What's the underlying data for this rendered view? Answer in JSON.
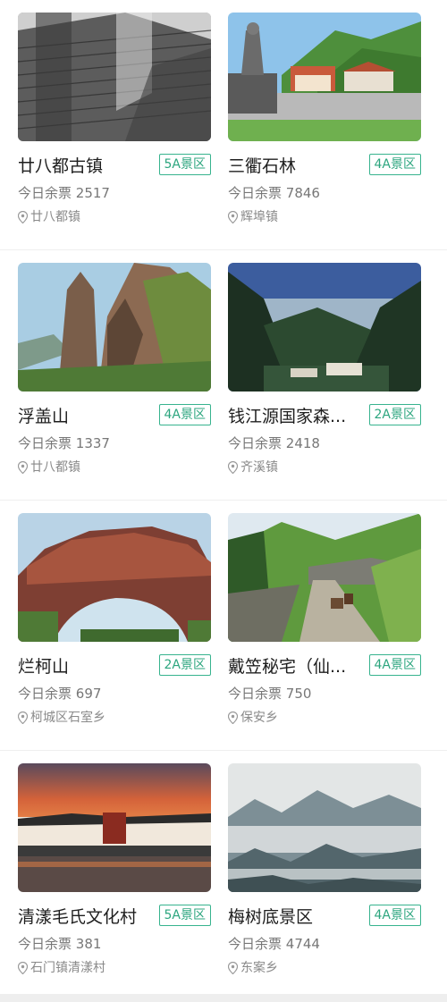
{
  "attractions": [
    {
      "name": "廿八都古镇",
      "grade": "5A景区",
      "tickets_label": "今日余票",
      "tickets": "2517",
      "location": "廿八都镇",
      "image": "old-town-rooftops-photo"
    },
    {
      "name": "三衢石林",
      "grade": "4A景区",
      "tickets_label": "今日余票",
      "tickets": "7846",
      "location": "辉埠镇",
      "image": "stone-forest-entrance-photo"
    },
    {
      "name": "浮盖山",
      "grade": "4A景区",
      "tickets_label": "今日余票",
      "tickets": "1337",
      "location": "廿八都镇",
      "image": "granite-peak-photo"
    },
    {
      "name": "钱江源国家森...",
      "grade": "2A景区",
      "tickets_label": "今日余票",
      "tickets": "2418",
      "location": "齐溪镇",
      "image": "misty-forest-valley-photo"
    },
    {
      "name": "烂柯山",
      "grade": "2A景区",
      "tickets_label": "今日余票",
      "tickets": "697",
      "location": "柯城区石室乡",
      "image": "rock-arch-photo"
    },
    {
      "name": "戴笠秘宅（仙...",
      "grade": "4A景区",
      "tickets_label": "今日余票",
      "tickets": "750",
      "location": "保安乡",
      "image": "mountain-path-horses-photo"
    },
    {
      "name": "清漾毛氏文化村",
      "grade": "5A景区",
      "tickets_label": "今日余票",
      "tickets": "381",
      "location": "石门镇清漾村",
      "image": "village-sunset-photo"
    },
    {
      "name": "梅树底景区",
      "grade": "4A景区",
      "tickets_label": "今日余票",
      "tickets": "4744",
      "location": "东案乡",
      "image": "sea-of-clouds-photo"
    }
  ],
  "colors": {
    "badge": "#2da67f",
    "text": "#1e1e1e",
    "muted": "#777777"
  },
  "icons": {
    "location": "location-pin-icon"
  }
}
